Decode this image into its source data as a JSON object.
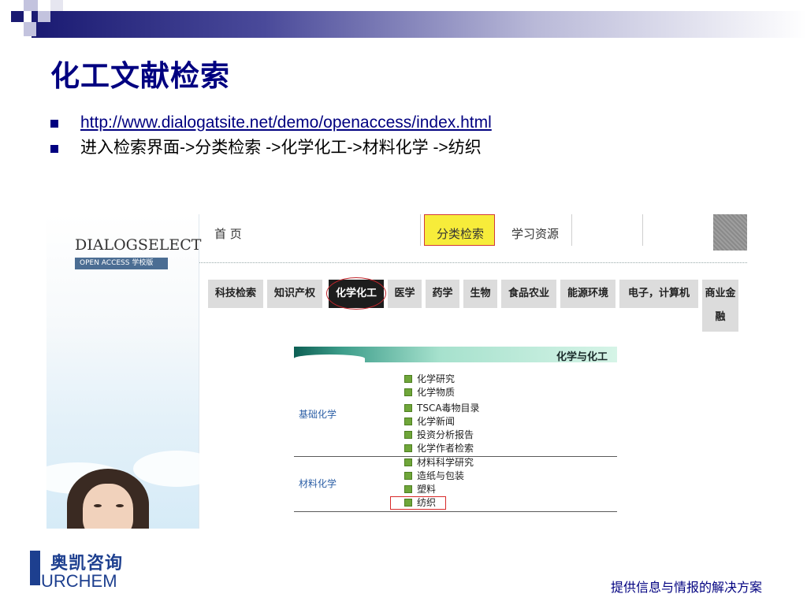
{
  "slide": {
    "title": "化工文献检索",
    "bullets": [
      {
        "text": "http://www.dialogatsite.net/demo/openaccess/index.html",
        "is_link": true
      },
      {
        "text": "进入检索界面->分类检索 ->化学化工->材料化学 ->纺织",
        "is_link": false
      }
    ]
  },
  "screenshot": {
    "brand": "DIALOGSELECT",
    "edition": "OPEN ACCESS 学校版",
    "top_nav": [
      {
        "label": "首  页",
        "active": false
      },
      {
        "label": "分类检索",
        "active": true
      },
      {
        "label": "学习资源",
        "active": false
      }
    ],
    "categories": [
      {
        "label": "科技检索",
        "active": false
      },
      {
        "label": "知识产权",
        "active": false
      },
      {
        "label": "化学化工",
        "active": true
      },
      {
        "label": "医学",
        "active": false
      },
      {
        "label": "药学",
        "active": false
      },
      {
        "label": "生物",
        "active": false
      },
      {
        "label": "食品农业",
        "active": false
      },
      {
        "label": "能源环境",
        "active": false
      },
      {
        "label": "电子，计算机",
        "active": false
      },
      {
        "label": "商业金融",
        "active": false
      }
    ],
    "section_title": "化学与化工",
    "groups": [
      {
        "label": "基础化学",
        "items": [
          "化学研究",
          "化学物质",
          "TSCA毒物目录",
          "化学新闻",
          "投资分析报告",
          "化学作者检索"
        ]
      },
      {
        "label": "材料化学",
        "items": [
          "材料科学研究",
          "造纸与包装",
          "塑料",
          "纺织"
        ]
      }
    ],
    "highlighted_item": "纺织"
  },
  "footer": {
    "logo_cn": "奥凯咨询",
    "logo_en": "URCHEM",
    "tagline": "提供信息与情报的解决方案"
  },
  "colors": {
    "title": "#000080",
    "highlight_yellow": "#f7ec3a",
    "highlight_red": "#d23a3a",
    "active_category": "#1d1d1d",
    "logo_blue": "#1d3f8f"
  }
}
